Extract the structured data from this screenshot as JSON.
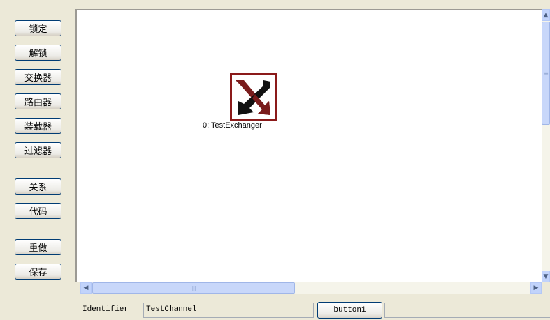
{
  "sidebar": {
    "buttons": [
      {
        "label": "锁定"
      },
      {
        "label": "解锁"
      },
      {
        "label": "交换器"
      },
      {
        "label": "路由器"
      },
      {
        "label": "装载器"
      },
      {
        "label": "过滤器"
      },
      {
        "label": "关系"
      },
      {
        "label": "代码"
      },
      {
        "label": "重做"
      },
      {
        "label": "保存"
      }
    ]
  },
  "canvas": {
    "nodes": [
      {
        "label": "0: TestExchanger",
        "icon": "exchanger-icon"
      }
    ]
  },
  "statusbar": {
    "identifier_label": "Identifier",
    "identifier_value": "TestChannel",
    "button_label": "button1",
    "extra_value": ""
  },
  "colors": {
    "node_border": "#8B1A1A",
    "node_arrow_red": "#7A1C1C",
    "node_arrow_black": "#111111",
    "button_border": "#003C74",
    "window_bg": "#ECE9D8"
  }
}
